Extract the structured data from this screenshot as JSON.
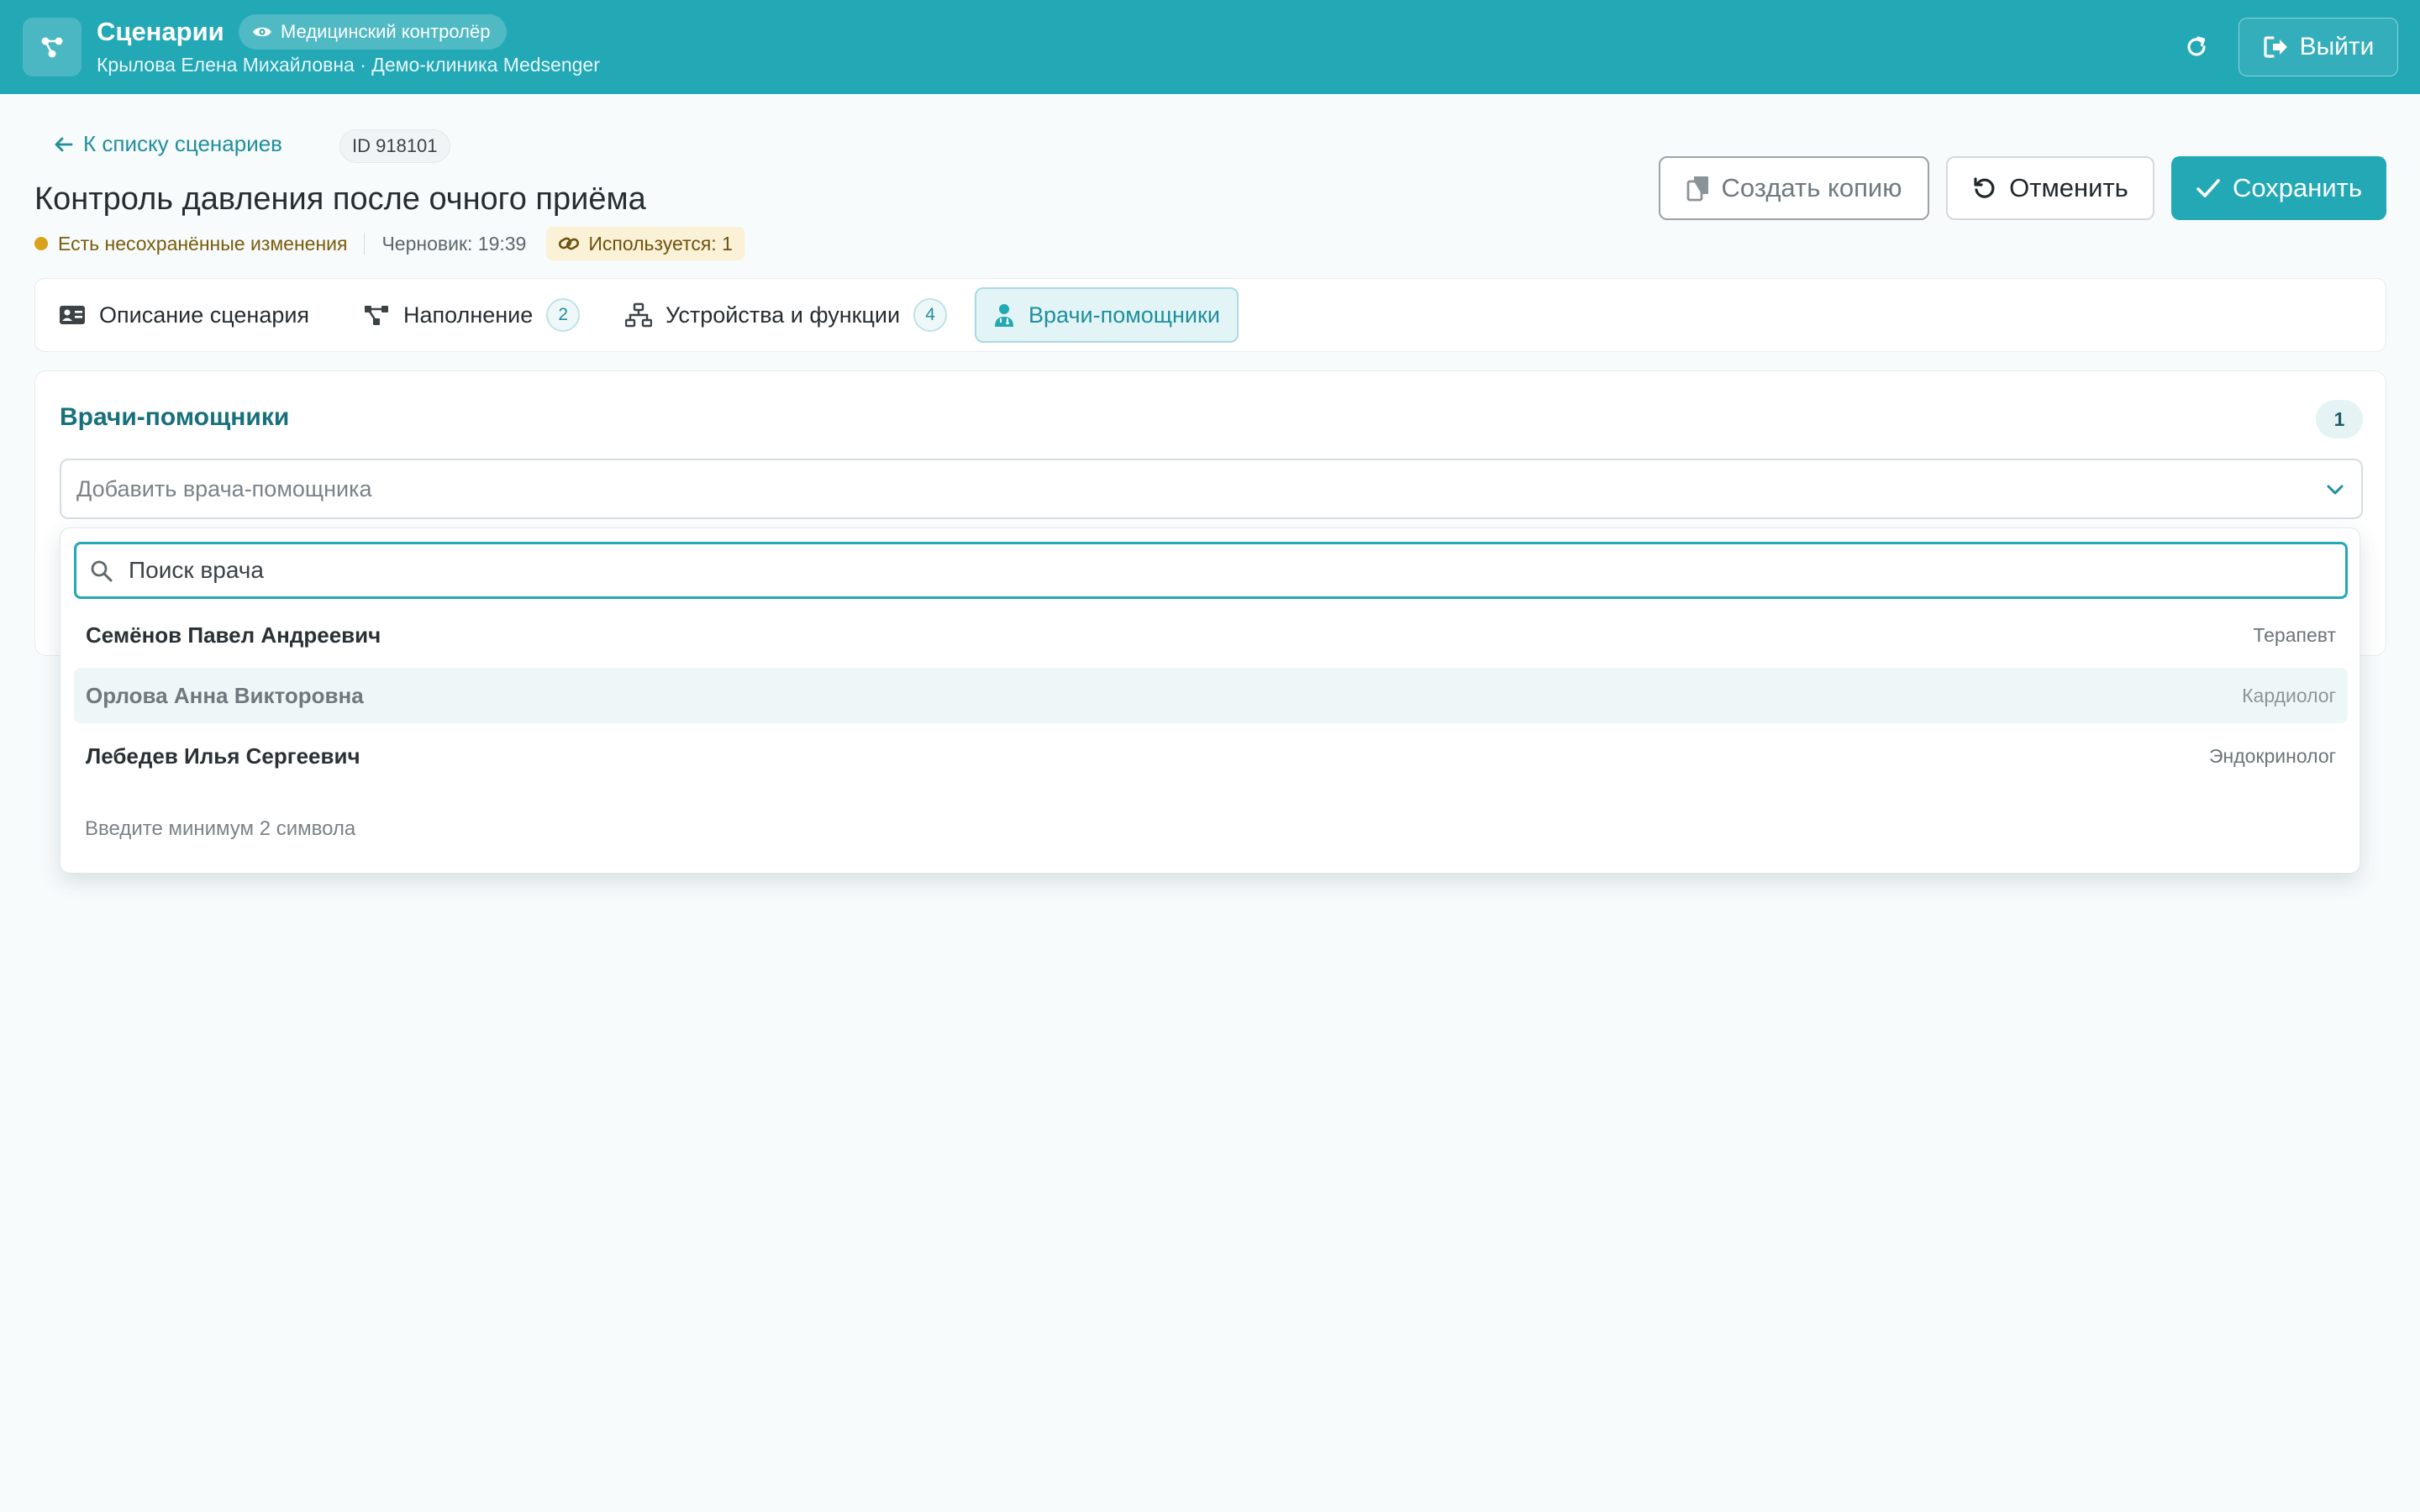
{
  "header": {
    "app_title": "Сценарии",
    "role_badge": "Медицинский контролёр",
    "user_line": "Крылова Елена Михайловна · Демо-клиника Medsenger",
    "logout_label": "Выйти"
  },
  "page": {
    "back_link": "К списку сценариев",
    "id_badge": "ID 918101",
    "title": "Контроль давления после очного приёма",
    "unsaved_text": "Есть несохранённые изменения",
    "draft_text": "Черновик: 19:39",
    "used_text": "Используется: 1"
  },
  "actions": {
    "copy_label": "Создать копию",
    "cancel_label": "Отменить",
    "save_label": "Сохранить"
  },
  "tabs": [
    {
      "label": "Описание сценария",
      "icon": "id-card-icon"
    },
    {
      "label": "Наполнение",
      "count": "2",
      "icon": "nodes-icon"
    },
    {
      "label": "Устройства и функции",
      "count": "4",
      "icon": "sitemap-icon"
    },
    {
      "label": "Врачи-помощники",
      "icon": "doctor-icon",
      "active": true
    }
  ],
  "assistants": {
    "title": "Врачи-помощники",
    "count": "1",
    "select_placeholder": "Добавить врача-помощника"
  },
  "dropdown": {
    "search_placeholder": "Поиск врача",
    "options": [
      {
        "name": "Семёнов Павел Андреевич",
        "specialty": "Терапевт"
      },
      {
        "name": "Орлова Анна Викторовна",
        "specialty": "Кардиолог"
      },
      {
        "name": "Лебедев Илья Сергеевич",
        "specialty": "Эндокринолог"
      }
    ],
    "hint": "Введите минимум 2 символа"
  },
  "colors": {
    "accent": "#23a8b6",
    "accent_dark": "#17707c",
    "warning_dot": "#d9a21b",
    "background": "#f8fbfc"
  }
}
